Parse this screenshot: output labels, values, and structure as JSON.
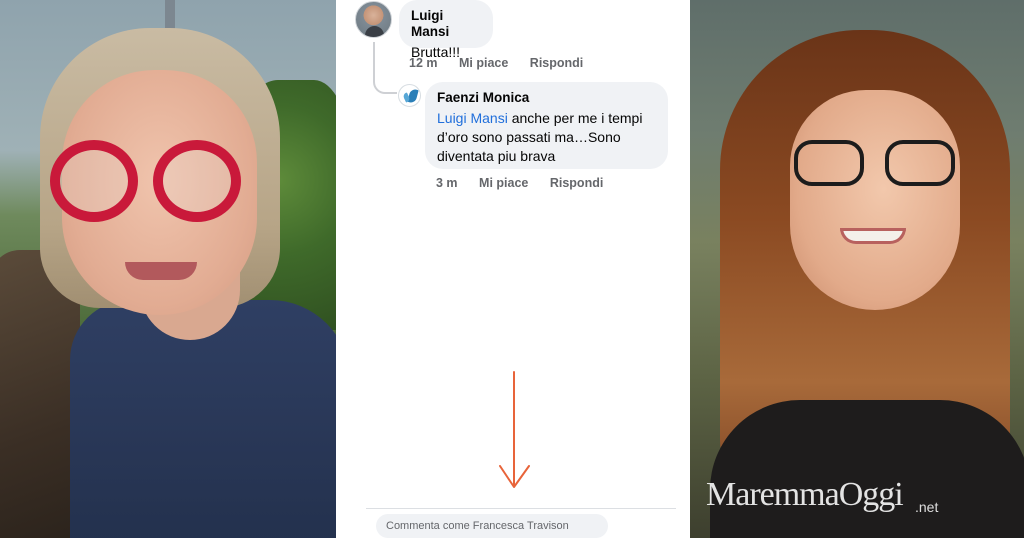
{
  "thread": {
    "comments": [
      {
        "author": "Luigi Mansi",
        "text": "Brutta!!!",
        "time": "12 m",
        "like_label": "Mi piace",
        "reply_label": "Rispondi"
      },
      {
        "author": "Faenzi Monica",
        "mention": "Luigi Mansi",
        "text": " anche per me i tempi d’oro sono passati ma…Sono diventata piu brava",
        "time": "3 m",
        "like_label": "Mi piace",
        "reply_label": "Rispondi"
      }
    ],
    "composer": {
      "placeholder": "Commenta come Francesca Travison"
    },
    "arrow_color": "#e8643a"
  },
  "watermark": {
    "brand": "MaremmaOggi",
    "suffix": ".net"
  },
  "colors": {
    "mention": "#216fdb",
    "bubble": "#f0f2f5",
    "meta": "#65676b"
  }
}
